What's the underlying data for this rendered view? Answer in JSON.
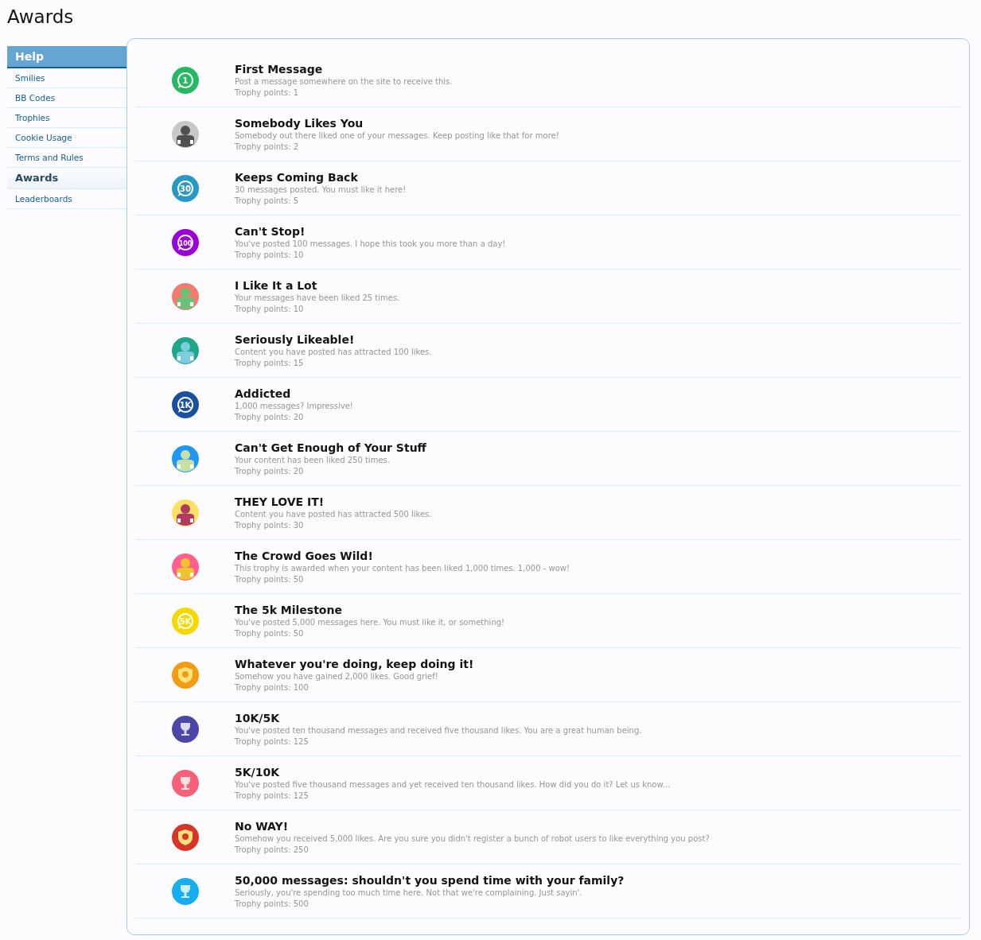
{
  "page_title": "Awards",
  "sidebar": {
    "heading": "Help",
    "items": [
      {
        "label": "Smilies",
        "selected": false
      },
      {
        "label": "BB Codes",
        "selected": false
      },
      {
        "label": "Trophies",
        "selected": false
      },
      {
        "label": "Cookie Usage",
        "selected": false
      },
      {
        "label": "Terms and Rules",
        "selected": false
      },
      {
        "label": "Awards",
        "selected": true
      },
      {
        "label": "Leaderboards",
        "selected": false
      }
    ]
  },
  "trophies": [
    {
      "title": "First Message",
      "description": "Post a message somewhere on the site to receive this.",
      "points": "Trophy points: 1",
      "icon": {
        "kind": "message",
        "badge_text": "1",
        "color": "#27b864"
      }
    },
    {
      "title": "Somebody Likes You",
      "description": "Somebody out there liked one of your messages. Keep posting like that for more!",
      "points": "Trophy points: 2",
      "icon": {
        "kind": "person",
        "color": "#c8c8c8",
        "figure": {
          "color": "#505050"
        }
      }
    },
    {
      "title": "Keeps Coming Back",
      "description": "30 messages posted. You must like it here!",
      "points": "Trophy points: 5",
      "icon": {
        "kind": "message",
        "badge_text": "30",
        "color": "#2a98c4"
      }
    },
    {
      "title": "Can't Stop!",
      "description": "You've posted 100 messages. I hope this took you more than a day!",
      "points": "Trophy points: 10",
      "icon": {
        "kind": "message",
        "badge_text": "100",
        "color": "#9b00d9"
      }
    },
    {
      "title": "I Like It a Lot",
      "description": "Your messages have been liked 25 times.",
      "points": "Trophy points: 10",
      "icon": {
        "kind": "person",
        "color": "#f47c6e",
        "figure": {
          "color": "#6cc17a"
        }
      }
    },
    {
      "title": "Seriously Likeable!",
      "description": "Content you have posted has attracted 100 likes.",
      "points": "Trophy points: 15",
      "icon": {
        "kind": "person",
        "color": "#1fa587",
        "figure": {
          "color": "#7dcde0"
        }
      }
    },
    {
      "title": "Addicted",
      "description": "1,000 messages? Impressive!",
      "points": "Trophy points: 20",
      "icon": {
        "kind": "message",
        "badge_text": "1K",
        "color": "#1b4fa0"
      }
    },
    {
      "title": "Can't Get Enough of Your Stuff",
      "description": "Your content has been liked 250 times.",
      "points": "Trophy points: 20",
      "icon": {
        "kind": "person",
        "color": "#2196f3",
        "figure": {
          "color": "#c5e1a5"
        }
      }
    },
    {
      "title": "THEY LOVE IT!",
      "description": "Content you have posted has attracted 500 likes.",
      "points": "Trophy points: 30",
      "icon": {
        "kind": "person",
        "color": "#ffe066",
        "figure": {
          "color": "#b03a60"
        }
      }
    },
    {
      "title": "The Crowd Goes Wild!",
      "description": "This trophy is awarded when your content has been liked 1,000 times. 1,000 - wow!",
      "points": "Trophy points: 50",
      "icon": {
        "kind": "person",
        "color": "#ff5f8f",
        "figure": {
          "color": "#f2c12e"
        }
      }
    },
    {
      "title": "The 5k Milestone",
      "description": "You've posted 5,000 messages here. You must like it, or something!",
      "points": "Trophy points: 50",
      "icon": {
        "kind": "message",
        "badge_text": "5K",
        "color": "#f5d800"
      }
    },
    {
      "title": "Whatever you're doing, keep doing it!",
      "description": "Somehow you have gained 2,000 likes. Good grief!",
      "points": "Trophy points: 100",
      "icon": {
        "kind": "shield",
        "color": "#f39c12"
      }
    },
    {
      "title": "10K/5K",
      "description": "You've posted ten thousand messages and received five thousand likes. You are a great human being.",
      "points": "Trophy points: 125",
      "icon": {
        "kind": "trophy",
        "color": "#4b46a8"
      }
    },
    {
      "title": "5K/10K",
      "description": "You've posted five thousand messages and yet received ten thousand likes. How did you do it? Let us know...",
      "points": "Trophy points: 125",
      "icon": {
        "kind": "trophy",
        "color": "#f7607a"
      }
    },
    {
      "title": "No WAY!",
      "description": "Somehow you received 5,000 likes. Are you sure you didn't register a bunch of robot users to like everything you post?",
      "points": "Trophy points: 250",
      "icon": {
        "kind": "shield",
        "color": "#d9342b"
      }
    },
    {
      "title": "50,000 messages: shouldn't you spend time with your family?",
      "description": "Seriously, you're spending too much time here. Not that we're complaining. Just sayin'.",
      "points": "Trophy points: 500",
      "icon": {
        "kind": "trophy",
        "color": "#16aef0"
      }
    }
  ]
}
